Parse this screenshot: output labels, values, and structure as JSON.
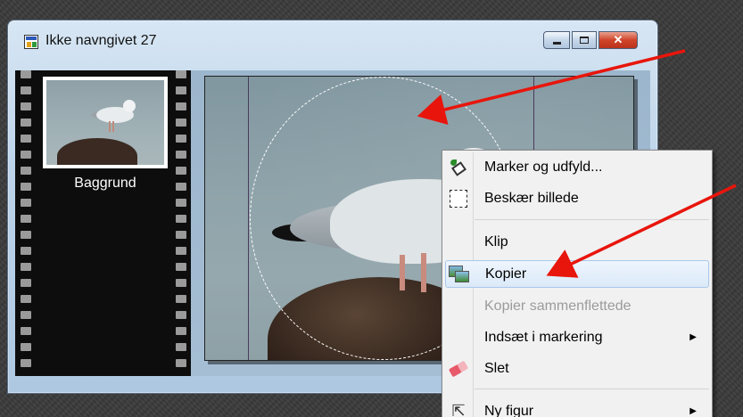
{
  "window": {
    "title": "Ikke navngivet 27",
    "buttons": {
      "minimize": "",
      "maximize": "",
      "close": "✕"
    }
  },
  "layers": {
    "items": [
      {
        "label": "Baggrund"
      }
    ]
  },
  "context_menu": {
    "items": [
      {
        "label": "Marker og udfyld...",
        "icon": "fill-bucket-icon",
        "enabled": true
      },
      {
        "label": "Beskær billede",
        "icon": "crop-icon",
        "enabled": true
      },
      {
        "label": "Klip",
        "icon": "",
        "enabled": true
      },
      {
        "label": "Kopier",
        "icon": "copy-image-icon",
        "enabled": true,
        "highlighted": true
      },
      {
        "label": "Kopier sammenflettede",
        "icon": "",
        "enabled": false
      },
      {
        "label": "Indsæt i markering",
        "icon": "",
        "enabled": true,
        "submenu": true
      },
      {
        "label": "Slet",
        "icon": "eraser-icon",
        "enabled": true
      },
      {
        "label": "Ny figur",
        "icon": "pointer-icon",
        "enabled": true,
        "submenu": true
      }
    ],
    "submenu_glyph": "▶"
  },
  "annotation": {
    "arrow_color": "#e8150c"
  }
}
